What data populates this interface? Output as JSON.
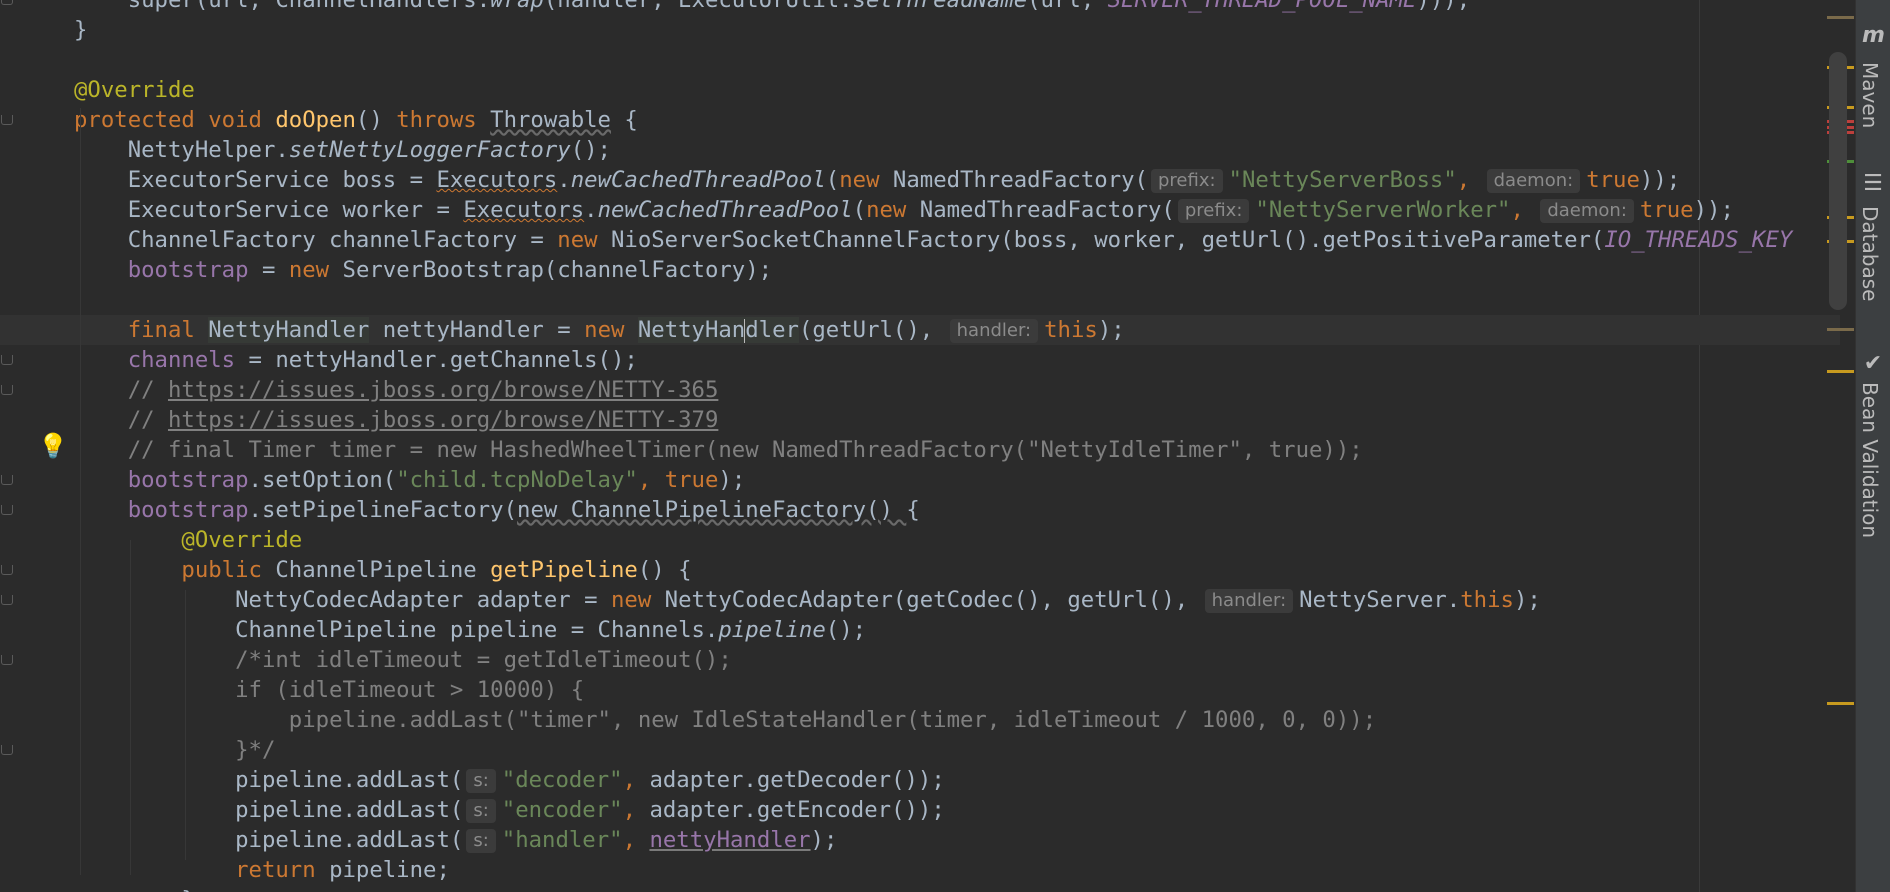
{
  "editor": {
    "lines": [
      {
        "indent": "    ",
        "tokens": [
          {
            "t": "super(url, ChannelHandlers.",
            "c": "plain"
          },
          {
            "t": "wrap",
            "c": "st"
          },
          {
            "t": "(handler, ExecutorUtil.",
            "c": "plain"
          },
          {
            "t": "setThreadName",
            "c": "st"
          },
          {
            "t": "(url, ",
            "c": "plain"
          },
          {
            "t": "SERVER_THREAD_POOL_NAME",
            "c": "cst"
          },
          {
            "t": ")));",
            "c": "plain"
          }
        ]
      },
      {
        "indent": "",
        "tokens": [
          {
            "t": "}",
            "c": "plain"
          }
        ]
      },
      {
        "indent": "",
        "tokens": []
      },
      {
        "indent": "",
        "tokens": [
          {
            "t": "@Override",
            "c": "ann"
          }
        ]
      },
      {
        "indent": "",
        "tokens": [
          {
            "t": "protected void ",
            "c": "kw"
          },
          {
            "t": "doOpen",
            "c": "fn"
          },
          {
            "t": "() ",
            "c": "plain"
          },
          {
            "t": "throws ",
            "c": "kw"
          },
          {
            "t": "Throwable",
            "c": "grey-sq"
          },
          {
            "t": " {",
            "c": "plain"
          }
        ]
      },
      {
        "indent": "    ",
        "tokens": [
          {
            "t": "NettyHelper.",
            "c": "plain"
          },
          {
            "t": "setNettyLoggerFactory",
            "c": "st"
          },
          {
            "t": "();",
            "c": "plain"
          }
        ]
      },
      {
        "indent": "    ",
        "tokens": [
          {
            "t": "ExecutorService boss = ",
            "c": "plain"
          },
          {
            "t": "Executors",
            "c": "squig"
          },
          {
            "t": ".",
            "c": "plain"
          },
          {
            "t": "newCachedThreadPool",
            "c": "st"
          },
          {
            "t": "(",
            "c": "plain"
          },
          {
            "t": "new ",
            "c": "kw"
          },
          {
            "t": "NamedThreadFactory(",
            "c": "plain"
          },
          {
            "t": "prefix:",
            "c": "hint"
          },
          {
            "t": "\"NettyServerBoss\"",
            "c": "str"
          },
          {
            "t": ", ",
            "c": "kw"
          },
          {
            "t": "daemon:",
            "c": "hint"
          },
          {
            "t": "true",
            "c": "kw"
          },
          {
            "t": "));",
            "c": "plain"
          }
        ]
      },
      {
        "indent": "    ",
        "tokens": [
          {
            "t": "ExecutorService worker = ",
            "c": "plain"
          },
          {
            "t": "Executors",
            "c": "squig"
          },
          {
            "t": ".",
            "c": "plain"
          },
          {
            "t": "newCachedThreadPool",
            "c": "st"
          },
          {
            "t": "(",
            "c": "plain"
          },
          {
            "t": "new ",
            "c": "kw"
          },
          {
            "t": "NamedThreadFactory(",
            "c": "plain"
          },
          {
            "t": "prefix:",
            "c": "hint"
          },
          {
            "t": "\"NettyServerWorker\"",
            "c": "str"
          },
          {
            "t": ", ",
            "c": "kw"
          },
          {
            "t": "daemon:",
            "c": "hint"
          },
          {
            "t": "true",
            "c": "kw"
          },
          {
            "t": "));",
            "c": "plain"
          }
        ]
      },
      {
        "indent": "    ",
        "tokens": [
          {
            "t": "ChannelFactory channelFactory = ",
            "c": "plain"
          },
          {
            "t": "new ",
            "c": "kw"
          },
          {
            "t": "NioServerSocketChannelFactory(boss, worker, getUrl().getPositiveParameter(",
            "c": "plain"
          },
          {
            "t": "IO_THREADS_KEY",
            "c": "cst"
          }
        ]
      },
      {
        "indent": "    ",
        "tokens": [
          {
            "t": "bootstrap",
            "c": "fld"
          },
          {
            "t": " = ",
            "c": "plain"
          },
          {
            "t": "new ",
            "c": "kw"
          },
          {
            "t": "ServerBootstrap(channelFactory);",
            "c": "plain"
          }
        ]
      },
      {
        "indent": "",
        "tokens": []
      },
      {
        "indent": "    ",
        "caret": true,
        "tokens": [
          {
            "t": "final ",
            "c": "kw"
          },
          {
            "t": "NettyHandler",
            "c": "hl"
          },
          {
            "t": " nettyHandler = ",
            "c": "plain"
          },
          {
            "t": "new ",
            "c": "kw"
          },
          {
            "t": "NettyHan",
            "c": "hl"
          },
          {
            "t": "",
            "c": "caret"
          },
          {
            "t": "dler",
            "c": "hl"
          },
          {
            "t": "(getUrl(), ",
            "c": "plain"
          },
          {
            "t": "handler:",
            "c": "hint"
          },
          {
            "t": "this",
            "c": "kw"
          },
          {
            "t": ");",
            "c": "plain"
          }
        ]
      },
      {
        "indent": "    ",
        "tokens": [
          {
            "t": "channels",
            "c": "fld"
          },
          {
            "t": " = nettyHandler.getChannels();",
            "c": "plain"
          }
        ]
      },
      {
        "indent": "    ",
        "tokens": [
          {
            "t": "// ",
            "c": "cmt"
          },
          {
            "t": "https://issues.jboss.org/browse/NETTY-365",
            "c": "link"
          }
        ]
      },
      {
        "indent": "    ",
        "tokens": [
          {
            "t": "// ",
            "c": "cmt"
          },
          {
            "t": "https://issues.jboss.org/browse/NETTY-379",
            "c": "link"
          }
        ]
      },
      {
        "indent": "    ",
        "tokens": [
          {
            "t": "// final Timer timer = new HashedWheelTimer(new NamedThreadFactory(\"NettyIdleTimer\", true));",
            "c": "cmt"
          }
        ]
      },
      {
        "indent": "    ",
        "tokens": [
          {
            "t": "bootstrap",
            "c": "fld"
          },
          {
            "t": ".setOption(",
            "c": "plain"
          },
          {
            "t": "\"child.tcpNoDelay\"",
            "c": "str"
          },
          {
            "t": ", ",
            "c": "kw"
          },
          {
            "t": "true",
            "c": "kw"
          },
          {
            "t": ");",
            "c": "plain"
          }
        ]
      },
      {
        "indent": "    ",
        "tokens": [
          {
            "t": "bootstrap",
            "c": "fld"
          },
          {
            "t": ".setPipelineFactory(",
            "c": "plain"
          },
          {
            "t": "new ChannelPipelineFactory() ",
            "c": "grey-sq"
          },
          {
            "t": "{",
            "c": "plain"
          }
        ]
      },
      {
        "indent": "        ",
        "tokens": [
          {
            "t": "@Override",
            "c": "ann"
          }
        ]
      },
      {
        "indent": "        ",
        "tokens": [
          {
            "t": "public ",
            "c": "kw"
          },
          {
            "t": "ChannelPipeline ",
            "c": "plain"
          },
          {
            "t": "getPipeline",
            "c": "fn"
          },
          {
            "t": "() {",
            "c": "plain"
          }
        ]
      },
      {
        "indent": "            ",
        "tokens": [
          {
            "t": "NettyCodecAdapter adapter = ",
            "c": "plain"
          },
          {
            "t": "new ",
            "c": "kw"
          },
          {
            "t": "NettyCodecAdapter(getCodec(), getUrl(), ",
            "c": "plain"
          },
          {
            "t": "handler:",
            "c": "hint"
          },
          {
            "t": "NettyServer.",
            "c": "plain"
          },
          {
            "t": "this",
            "c": "kw"
          },
          {
            "t": ");",
            "c": "plain"
          }
        ]
      },
      {
        "indent": "            ",
        "tokens": [
          {
            "t": "ChannelPipeline pipeline = Channels.",
            "c": "plain"
          },
          {
            "t": "pipeline",
            "c": "st"
          },
          {
            "t": "();",
            "c": "plain"
          }
        ]
      },
      {
        "indent": "            ",
        "tokens": [
          {
            "t": "/*int idleTimeout = getIdleTimeout();",
            "c": "cmt"
          }
        ]
      },
      {
        "indent": "            ",
        "tokens": [
          {
            "t": "if (idleTimeout > 10000) {",
            "c": "cmt"
          }
        ]
      },
      {
        "indent": "                ",
        "tokens": [
          {
            "t": "pipeline.addLast(\"timer\", new IdleStateHandler(timer, idleTimeout / 1000, 0, 0));",
            "c": "cmt"
          }
        ]
      },
      {
        "indent": "            ",
        "tokens": [
          {
            "t": "}*/",
            "c": "cmt"
          }
        ]
      },
      {
        "indent": "            ",
        "tokens": [
          {
            "t": "pipeline.addLast(",
            "c": "plain"
          },
          {
            "t": "s:",
            "c": "hint"
          },
          {
            "t": "\"decoder\"",
            "c": "str"
          },
          {
            "t": ", ",
            "c": "kw"
          },
          {
            "t": "adapter.getDecoder());",
            "c": "plain"
          }
        ]
      },
      {
        "indent": "            ",
        "tokens": [
          {
            "t": "pipeline.addLast(",
            "c": "plain"
          },
          {
            "t": "s:",
            "c": "hint"
          },
          {
            "t": "\"encoder\"",
            "c": "str"
          },
          {
            "t": ", ",
            "c": "kw"
          },
          {
            "t": "adapter.getEncoder());",
            "c": "plain"
          }
        ]
      },
      {
        "indent": "            ",
        "tokens": [
          {
            "t": "pipeline.addLast(",
            "c": "plain"
          },
          {
            "t": "s:",
            "c": "hint"
          },
          {
            "t": "\"handler\"",
            "c": "str"
          },
          {
            "t": ", ",
            "c": "kw"
          },
          {
            "t": "nettyHandler",
            "c": "fld uline"
          },
          {
            "t": ");",
            "c": "plain"
          }
        ]
      },
      {
        "indent": "            ",
        "tokens": [
          {
            "t": "return ",
            "c": "kw"
          },
          {
            "t": "pipeline;",
            "c": "plain"
          }
        ]
      },
      {
        "indent": "        ",
        "tokens": [
          {
            "t": "}",
            "c": "plain"
          }
        ]
      }
    ]
  },
  "error_stripe": {
    "marks": [
      {
        "color": "#7a6a4a"
      },
      {
        "color": "#c79a1f"
      },
      {
        "color": "#c79a1f"
      },
      {
        "color": "#bc3f3c"
      },
      {
        "color": "#bc3f3c"
      },
      {
        "color": "#bc3f3c"
      },
      {
        "color": "#4e8f3a"
      },
      {
        "color": "#c79a1f"
      },
      {
        "color": "#c79a1f"
      },
      {
        "color": "#7a6a4a"
      },
      {
        "color": "#c79a1f"
      },
      {
        "color": "#c79a1f"
      }
    ]
  },
  "tool_windows": [
    {
      "label": "Maven",
      "icon": "maven-icon",
      "glyph": "m"
    },
    {
      "label": "Database",
      "icon": "database-icon",
      "glyph": "☰"
    },
    {
      "label": "Bean Validation",
      "icon": "bean-validation-icon",
      "glyph": "✔"
    }
  ],
  "intention_bulb": {
    "icon": "lightbulb-icon",
    "glyph": "💡",
    "color": "#e8b32b"
  }
}
